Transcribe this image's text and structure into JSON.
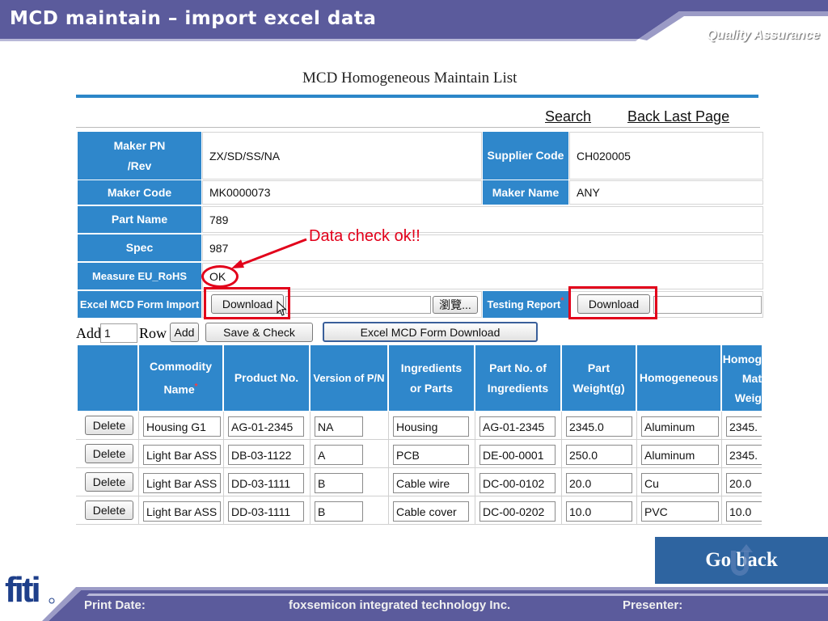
{
  "slide": {
    "title": "MCD maintain – import excel data",
    "subtitle": "Quality Assurance"
  },
  "page_title": "MCD Homogeneous Maintain List",
  "nav": {
    "search": "Search",
    "back": "Back Last Page"
  },
  "form": {
    "maker_pn_label_1": "Maker PN",
    "maker_pn_label_2": "/Rev",
    "maker_pn": "ZX/SD/SS/NA",
    "supplier_code_label": "Supplier Code",
    "supplier_code": "CH020005",
    "maker_code_label": "Maker Code",
    "maker_code": "MK0000073",
    "maker_name_label": "Maker Name",
    "maker_name": "ANY",
    "part_name_label": "Part Name",
    "part_name": "789",
    "spec_label": "Spec",
    "spec": "987",
    "measure_label": "Measure EU_RoHS",
    "measure": "OK",
    "excel_import_label": "Excel MCD Form Import",
    "download_label": "Download",
    "browse_label": "瀏覽...",
    "testing_report_label": "Testing Report",
    "required_mark": "*",
    "testing_download_label": "Download"
  },
  "annotation": {
    "callout": "Data check ok!!"
  },
  "toolbar": {
    "add_prefix": "Add",
    "row_count": "1",
    "row_label": "Row",
    "add_button": "Add",
    "save_check": "Save & Check",
    "excel_download": "Excel MCD Form Download"
  },
  "grid": {
    "headers": {
      "commodity_1": "Commodity",
      "commodity_2": "Name",
      "product_no": "Product No.",
      "version": "Version of P/N",
      "ingredients_1": "Ingredients",
      "ingredients_2": "or Parts",
      "partno_1": "Part No. of",
      "partno_2": "Ingredients",
      "weight_1": "Part",
      "weight_2": "Weight(g)",
      "homogeneous": "Homogeneous",
      "homo_mat_1": "Homog",
      "homo_mat_2": "Mat",
      "homo_mat_3": "Weig"
    },
    "delete_label": "Delete",
    "rows": [
      {
        "commodity": "Housing G1",
        "product": "AG-01-2345",
        "version": "NA",
        "ingredient": "Housing",
        "partno": "AG-01-2345",
        "weight": "2345.0",
        "homogeneous": "Aluminum",
        "material_weight": "2345."
      },
      {
        "commodity": "Light Bar ASS",
        "product": "DB-03-1122",
        "version": "A",
        "ingredient": "PCB",
        "partno": "DE-00-0001",
        "weight": "250.0",
        "homogeneous": "Aluminum",
        "material_weight": "2345."
      },
      {
        "commodity": "Light Bar ASS",
        "product": "DD-03-1111",
        "version": "B",
        "ingredient": "Cable wire",
        "partno": "DC-00-0102",
        "weight": "20.0",
        "homogeneous": "Cu",
        "material_weight": "20.0"
      },
      {
        "commodity": "Light Bar ASS",
        "product": "DD-03-1111",
        "version": "B",
        "ingredient": "Cable cover",
        "partno": "DC-00-0202",
        "weight": "10.0",
        "homogeneous": "PVC",
        "material_weight": "10.0"
      }
    ]
  },
  "go_back": "Go back",
  "footer": {
    "print_date": "Print Date:",
    "company": "foxsemicon integrated technology Inc.",
    "presenter": "Presenter:"
  },
  "logo_text": "fiti",
  "colors": {
    "header_band": "#5a5a9a",
    "table_header": "#2f87cb",
    "accent_red": "#e2001a",
    "go_back": "#2e64a0"
  }
}
